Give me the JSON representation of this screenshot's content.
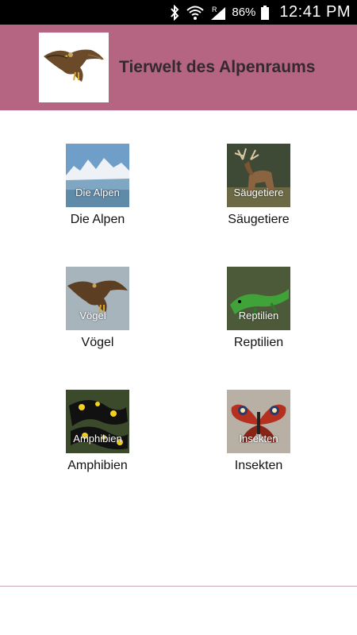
{
  "status_bar": {
    "battery_percent": "86%",
    "time": "12:41 PM",
    "signal_badge": "R",
    "icons": [
      "bluetooth-icon",
      "wifi-icon",
      "cell-signal-icon",
      "battery-icon"
    ]
  },
  "header": {
    "title": "Tierwelt des Alpenraums",
    "background_color": "#b56582",
    "logo_icon": "eagle-icon"
  },
  "categories": [
    {
      "label": "Die Alpen",
      "thumb_label": "Die Alpen",
      "icon": "mountains-image"
    },
    {
      "label": "Säugetiere",
      "thumb_label": "Säugetiere",
      "icon": "deer-image"
    },
    {
      "label": "Vögel",
      "thumb_label": "Vögel",
      "icon": "eagle-image"
    },
    {
      "label": "Reptilien",
      "thumb_label": "Reptilien",
      "icon": "lizard-image"
    },
    {
      "label": "Amphibien",
      "thumb_label": "Amphibien",
      "icon": "salamander-image"
    },
    {
      "label": "Insekten",
      "thumb_label": "Insekten",
      "icon": "butterfly-image"
    }
  ]
}
